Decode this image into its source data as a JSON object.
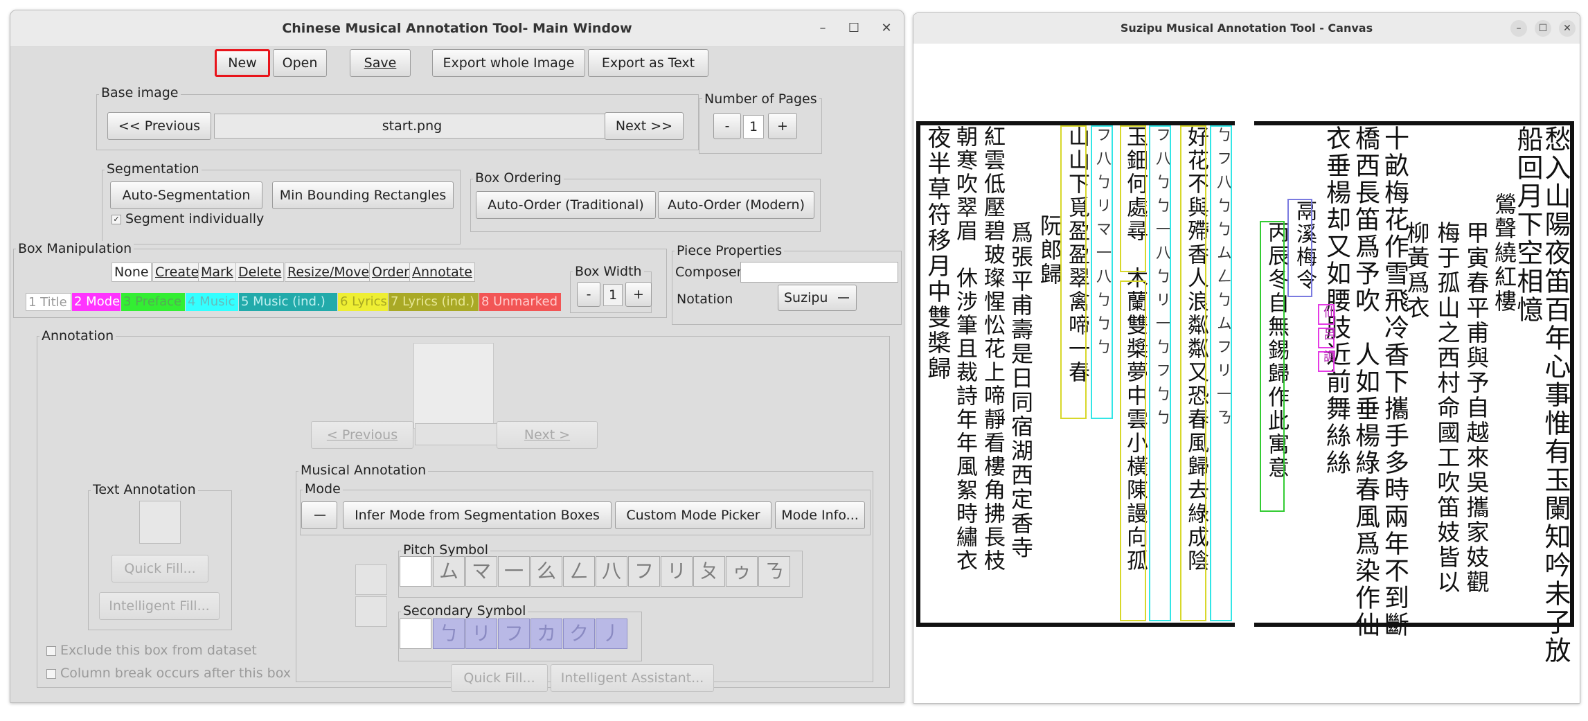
{
  "main_window": {
    "title": "Chinese Musical Annotation Tool- Main Window",
    "controls": {
      "minimize": "–",
      "maximize": "☐",
      "close": "✕"
    },
    "toolbar": {
      "new": "New",
      "open": "Open",
      "save": "Save",
      "export_image": "Export whole Image",
      "export_text": "Export as Text"
    },
    "base_image": {
      "label": "Base image",
      "previous": "<< Previous",
      "filename": "start.png",
      "next": "Next >>"
    },
    "pages": {
      "label": "Number of Pages",
      "minus": "-",
      "value": "1",
      "plus": "+"
    },
    "segmentation": {
      "label": "Segmentation",
      "auto": "Auto-Segmentation",
      "min_rect": "Min Bounding Rectangles",
      "individual": "Segment individually",
      "individual_checked": true
    },
    "box_ordering": {
      "label": "Box Ordering",
      "traditional": "Auto-Order (Traditional)",
      "modern": "Auto-Order (Modern)"
    },
    "box_manipulation": {
      "label": "Box Manipulation",
      "modes": [
        "None",
        "Create",
        "Mark",
        "Delete",
        "Resize/Move",
        "Order",
        "Annotate"
      ],
      "categories": [
        {
          "label": "1 Title",
          "color": "#ffffff",
          "text_color": "#999999"
        },
        {
          "label": "2 Mode",
          "color": "#ff33ff",
          "text_color": "#ffffff"
        },
        {
          "label": "3 Preface",
          "color": "#33ee33",
          "text_color": "#55aa55"
        },
        {
          "label": "4 Music",
          "color": "#33ffff",
          "text_color": "#66bbbb"
        },
        {
          "label": "5 Music (ind.)",
          "color": "#22aaaa",
          "text_color": "#bff0f0"
        },
        {
          "label": "6 Lyrics",
          "color": "#eeee33",
          "text_color": "#a8a822"
        },
        {
          "label": "7 Lyrics (ind.)",
          "color": "#a9a926",
          "text_color": "#e7e795"
        },
        {
          "label": "8 Unmarked",
          "color": "#f25555",
          "text_color": "#ffcccc"
        }
      ]
    },
    "box_width": {
      "label": "Box Width",
      "minus": "-",
      "value": "1",
      "plus": "+"
    },
    "piece_properties": {
      "label": "Piece Properties",
      "composer_label": "Composer",
      "composer_value": "",
      "notation_label": "Notation",
      "notation_value": "Suzipu"
    },
    "annotation": {
      "label": "Annotation",
      "previous": "< Previous",
      "next": "Next >",
      "text_annotation": {
        "label": "Text Annotation",
        "quick_fill": "Quick Fill...",
        "intelligent_fill": "Intelligent Fill..."
      },
      "musical_annotation": {
        "label": "Musical Annotation",
        "mode_label": "Mode",
        "infer_mode": "Infer Mode from Segmentation Boxes",
        "custom_mode": "Custom Mode Picker",
        "mode_info": "Mode Info...",
        "pitch_label": "Pitch Symbol",
        "pitch_symbols": [
          "ム",
          "マ",
          "一",
          "么",
          "ㄥ",
          "八",
          "フ",
          "リ",
          "ㄆ",
          "ゥ",
          "ㄋ"
        ],
        "secondary_label": "Secondary Symbol",
        "secondary_symbols": [
          "ㄅ",
          "リ",
          "フ",
          "カ",
          "ク",
          "丿"
        ],
        "quick_fill": "Quick Fill...",
        "intelligent_assistant": "Intelligent Assistant..."
      },
      "exclude": "Exclude this box from dataset",
      "column_break": "Column break occurs after this box"
    }
  },
  "canvas_window": {
    "title": "Suzipu Musical Annotation Tool - Canvas",
    "controls": {
      "minimize": "–",
      "maximize": "☐",
      "close": "✕"
    },
    "columns": [
      "愁入山陽夜笛百年心事惟有玉闌知吟未了放",
      "船回月下空相憶",
      "鶯聲繞紅樓",
      "甲寅春平甫與予自越來吳攜家妓觀",
      "梅于孤山之西村命國工吹笛妓皆以",
      "柳黃爲衣",
      "十畝梅花作雪飛冷香下攜手多時兩年不到斷",
      "橋西長笛爲予吹　人如垂楊綠春風爲染作仙",
      "衣垂楊却又如腰肢近前舞絲絲",
      "鬲溪梅令",
      "丙辰冬自無錫歸作此寓意",
      "好花不與殢香人浪粼粼又恐春風歸去綠成陰",
      "玉鈿何處尋　木蘭雙槳夢中雲小橫陳謾向孤",
      "山山下覓盈盈翠禽啼一春",
      "阮郎歸",
      "爲張平甫壽是日同宿湖西定香寺",
      "紅雲低壓碧玻璨惺忪花上啼靜看樓角拂長枝",
      "朝寒吹翠眉　休涉筆且裁詩年年風絮時繡衣",
      "夜半草符移月中雙槳歸"
    ],
    "mode_marks": [
      "仙",
      "呂",
      "調"
    ]
  }
}
